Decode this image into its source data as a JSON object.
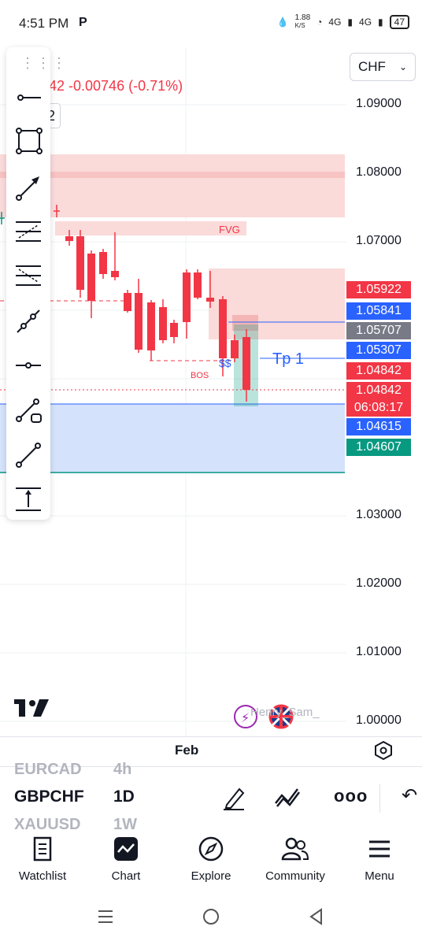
{
  "status_bar": {
    "time": "4:51 PM",
    "app_indicator": "P",
    "net_speed_value": "1.88",
    "net_speed_unit": "K/S",
    "signal1": "4G",
    "signal2": "4G",
    "battery": "47"
  },
  "chart": {
    "currency": "CHF",
    "change_text": "42  -0.00746 (-0.71%)",
    "partial_button_text": "2",
    "fvg_label": "FVG",
    "bos_label": "BOS",
    "tp_label": "Tp 1",
    "watermark_text": "Henry_Sam_",
    "price_ticks": [
      "1.09000",
      "1.08000",
      "1.07000",
      "1.03000",
      "1.02000",
      "1.01000",
      "1.00000"
    ],
    "price_tags": [
      {
        "value": "1.05922",
        "color": "#f23645"
      },
      {
        "value": "1.05841",
        "color": "#2962ff"
      },
      {
        "value": "1.05707",
        "color": "#787b86"
      },
      {
        "value": "1.05307",
        "color": "#2962ff"
      },
      {
        "value": "1.04842",
        "color": "#f23645"
      },
      {
        "value": "1.04842",
        "color": "#f23645"
      },
      {
        "value": "06:08:17",
        "color": "#f23645"
      },
      {
        "value": "1.04615",
        "color": "#2962ff"
      },
      {
        "value": "1.04607",
        "color": "#089981"
      }
    ],
    "time_label": "Feb"
  },
  "symbols": {
    "prev_symbol": "EURCAD",
    "prev_interval": "4h",
    "current_symbol": "GBPCHF",
    "current_interval": "1D",
    "next_symbol": "XAUUSD",
    "next_interval": "1W"
  },
  "toolbox": {
    "tools": [
      "horizontal-ray-icon",
      "rectangle-icon",
      "arrow-icon",
      "fib-retracement-icon",
      "fib-extension-icon",
      "trend-line-icon",
      "horizontal-line-icon",
      "ruler-icon",
      "line-icon",
      "date-range-icon"
    ]
  },
  "bottom_nav": {
    "items": [
      {
        "label": "Watchlist"
      },
      {
        "label": "Chart"
      },
      {
        "label": "Explore"
      },
      {
        "label": "Community"
      },
      {
        "label": "Menu"
      }
    ]
  },
  "colors": {
    "up": "#089981",
    "down": "#f23645",
    "blue": "#2962ff",
    "zone_red": "#fbdada",
    "zone_blue": "#d4e2fb"
  }
}
